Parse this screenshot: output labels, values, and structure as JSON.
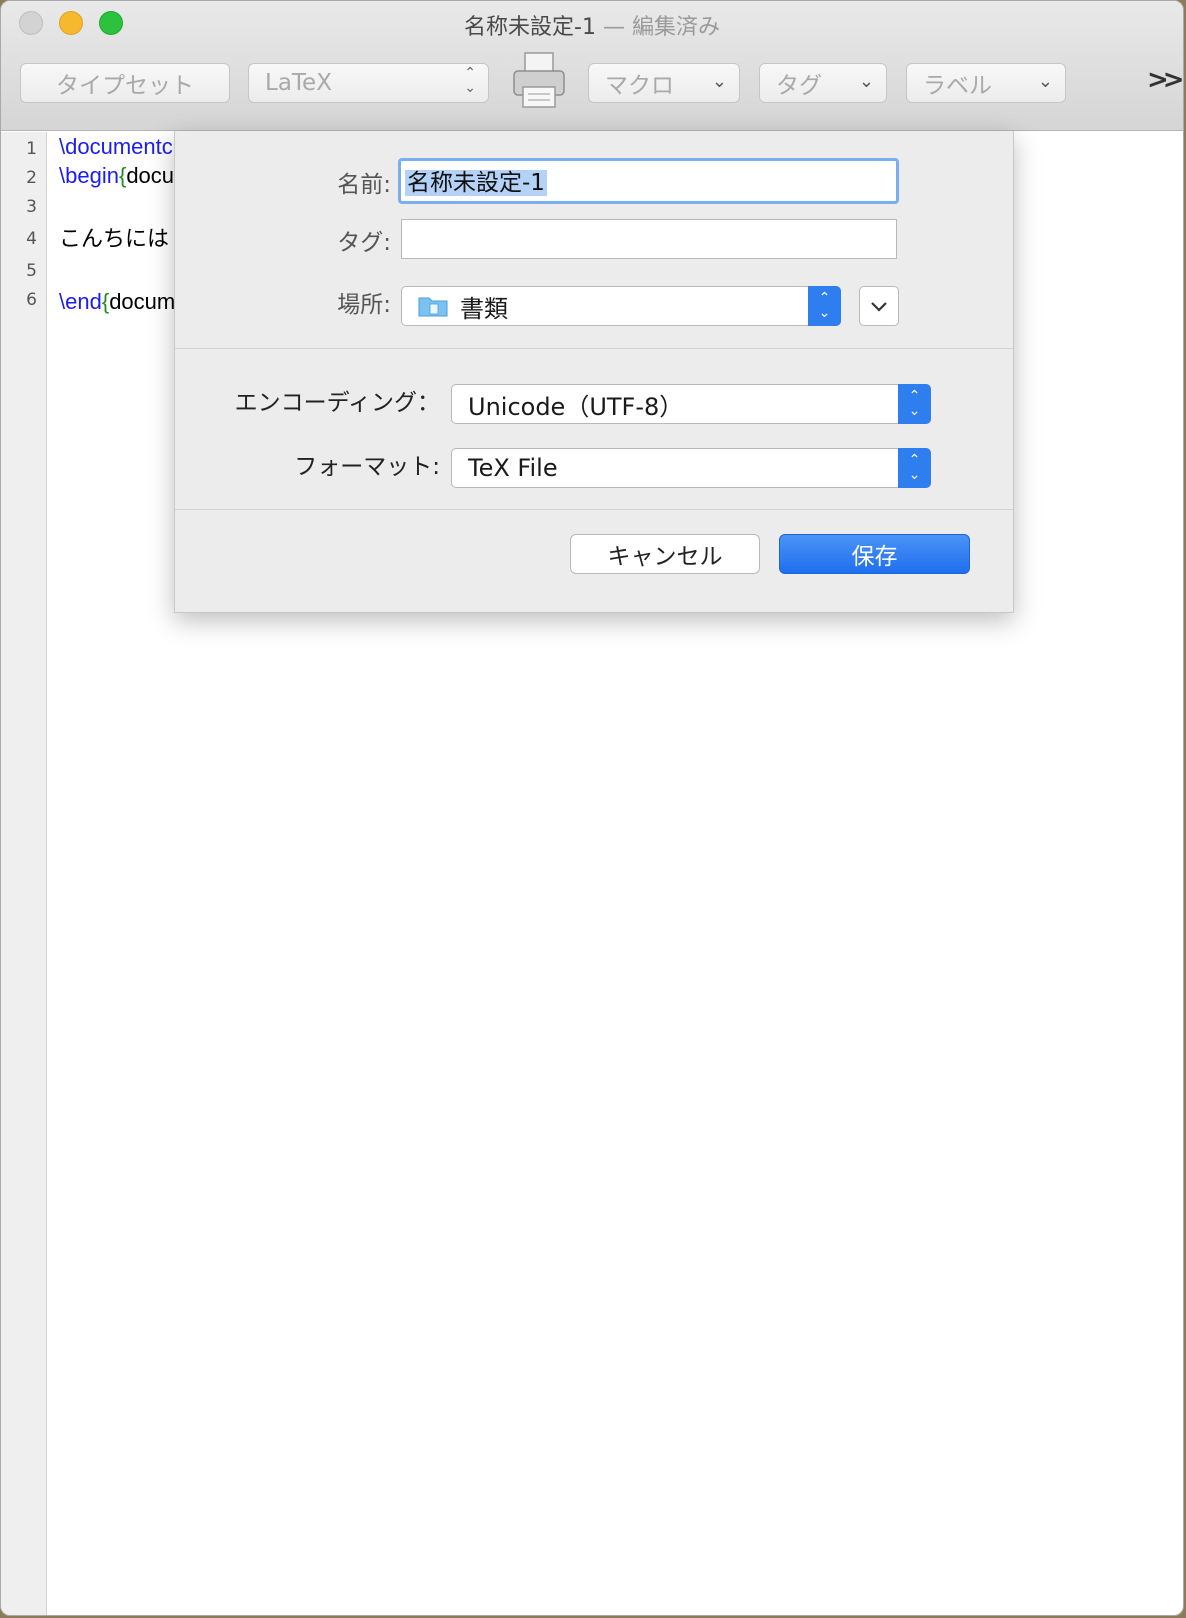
{
  "window": {
    "title": "名称未設定-1",
    "title_suffix": " — 編集済み"
  },
  "toolbar": {
    "typeset_label": "タイプセット",
    "engine_value": "LaTeX",
    "macro_label": "マクロ",
    "tag_label": "タグ",
    "label_label": "ラベル",
    "overflow_label": ">>"
  },
  "editor": {
    "lines": [
      {
        "num": "1",
        "cmd": "\\documentc",
        "brace": "",
        "text": ""
      },
      {
        "num": "2",
        "cmd": "\\begin",
        "brace": "{",
        "text": "docu"
      },
      {
        "num": "3",
        "cmd": "",
        "brace": "",
        "text": ""
      },
      {
        "num": "4",
        "cmd": "",
        "brace": "",
        "text": "こんちには"
      },
      {
        "num": "5",
        "cmd": "",
        "brace": "",
        "text": ""
      },
      {
        "num": "6",
        "cmd": "\\end",
        "brace": "{",
        "text": "docum"
      }
    ]
  },
  "save_sheet": {
    "name_label": "名前:",
    "name_value": "名称未設定-1",
    "tags_label": "タグ:",
    "tags_value": "",
    "location_label": "場所:",
    "location_value": "書類",
    "encoding_label": "エンコーディング：",
    "encoding_value": "Unicode（UTF-8）",
    "format_label": "フォーマット:",
    "format_value": "TeX File",
    "cancel_label": "キャンセル",
    "save_label": "保存"
  },
  "colors": {
    "accent": "#2f7ef0",
    "command": "#1b1ef0",
    "brace": "#1e8f1e"
  },
  "icons": [
    "printer-icon",
    "folder-icon",
    "chevron-down-icon",
    "updown-icon",
    "overflow-chevrons-icon"
  ]
}
